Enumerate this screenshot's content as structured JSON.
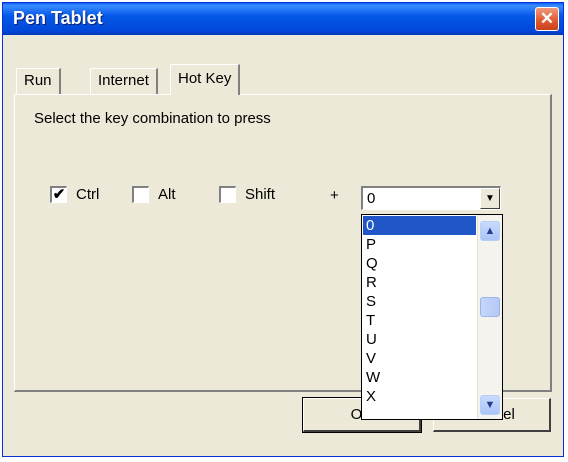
{
  "window": {
    "title": "Pen Tablet",
    "close_glyph": "✕"
  },
  "tabs": [
    {
      "label": "Run"
    },
    {
      "label": "Internet"
    },
    {
      "label": "Hot Key"
    }
  ],
  "hotkey": {
    "prompt": "Select the key combination to press",
    "modifiers": [
      {
        "label": "Ctrl",
        "checked": true,
        "mark": "✔"
      },
      {
        "label": "Alt",
        "checked": false,
        "mark": ""
      },
      {
        "label": "Shift",
        "checked": false,
        "mark": ""
      }
    ],
    "plus": "+",
    "key_value": "0",
    "dropdown_arrow": "▼",
    "options": [
      "0",
      "P",
      "Q",
      "R",
      "S",
      "T",
      "U",
      "V",
      "W",
      "X"
    ],
    "selected_index": 0,
    "scroll_up_glyph": "▲",
    "scroll_down_glyph": "▼"
  },
  "buttons": {
    "ok": "OK",
    "cancel": "Cancel"
  },
  "colors": {
    "titlebar": "#0558e8",
    "selection": "#2056c8",
    "dialog": "#ece9d8"
  }
}
